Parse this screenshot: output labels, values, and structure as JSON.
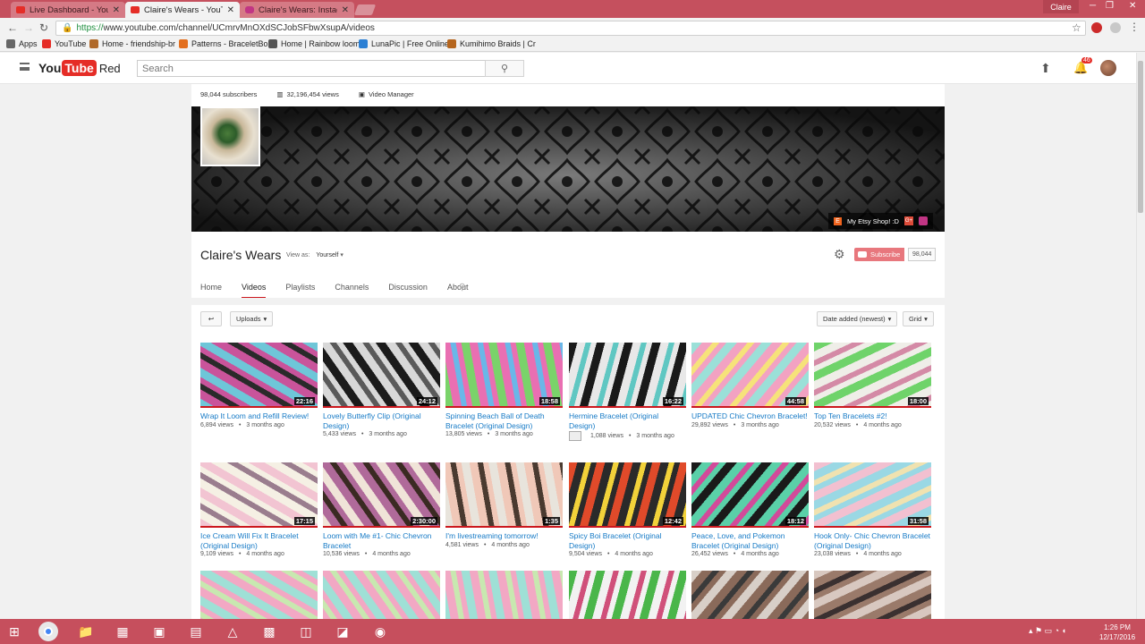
{
  "browser": {
    "tabs": [
      {
        "title": "Live Dashboard - YouTu",
        "icon": "youtube-favicon"
      },
      {
        "title": "Claire's Wears - YouTube",
        "icon": "youtube-favicon"
      },
      {
        "title": "Claire's Wears: Instagram",
        "icon": "instagram-favicon"
      }
    ],
    "profile_name": "Claire",
    "url_scheme": "https://",
    "url_rest": "www.youtube.com/channel/UCmrvMnOXdSCJobSFbwXsupA/videos",
    "bookmarks": [
      {
        "label": "Apps",
        "color": "#666666"
      },
      {
        "label": "YouTube",
        "color": "#e52d27"
      },
      {
        "label": "Home - friendship-br",
        "color": "#b06a2a"
      },
      {
        "label": "Patterns - BraceletBo",
        "color": "#e36f1e"
      },
      {
        "label": "Home | Rainbow loom",
        "color": "#555555"
      },
      {
        "label": "LunaPic | Free Online",
        "color": "#2a7fd4"
      },
      {
        "label": "Kumihimo Braids | Cr",
        "color": "#b5651d"
      }
    ]
  },
  "youtube": {
    "logo_you": "You",
    "logo_tube": "Tube",
    "logo_red": "Red",
    "search_placeholder": "Search",
    "notif_count": "46"
  },
  "channel": {
    "subscribers": "98,044 subscribers",
    "views": "32,196,454 views",
    "video_manager": "Video Manager",
    "name": "Claire's Wears",
    "view_as_label": "View as:",
    "view_as_value": "Yourself",
    "etsy_link": "My Etsy Shop! :D",
    "subscribe_label": "Subscribe",
    "subscribe_count": "98,044",
    "nav_tabs": [
      "Home",
      "Videos",
      "Playlists",
      "Channels",
      "Discussion",
      "About"
    ],
    "uploads_label": "Uploads",
    "sort_label": "Date added (newest)",
    "layout_label": "Grid"
  },
  "videos": [
    {
      "title": "Wrap It Loom and Refill Review!",
      "views": "6,894 views",
      "age": "3 months ago",
      "duration": "22:16",
      "colors": [
        "#6ec6d8",
        "#c9549b",
        "#2a2a2a"
      ]
    },
    {
      "title": "Lovely Butterfly Clip (Original Design)",
      "views": "5,433 views",
      "age": "3 months ago",
      "duration": "24:12",
      "colors": [
        "#1b1b1b",
        "#d8d8d8",
        "#5a5a5a"
      ]
    },
    {
      "title": "Spinning Beach Ball of Death Bracelet (Original Design)",
      "views": "13,805 views",
      "age": "3 months ago",
      "duration": "18:58",
      "colors": [
        "#7ad36a",
        "#e96fb2",
        "#6ab7e8"
      ]
    },
    {
      "title": "Hermine Bracelet (Original Design)",
      "views": "1,088 views",
      "age": "3 months ago",
      "duration": "16:22",
      "colors": [
        "#1a1a1a",
        "#e8e8e8",
        "#5fc7c2"
      ]
    },
    {
      "title": "UPDATED Chic Chevron Bracelet!",
      "views": "29,892 views",
      "age": "3 months ago",
      "duration": "44:58",
      "colors": [
        "#9be0d8",
        "#f2a2c2",
        "#f6e27a"
      ]
    },
    {
      "title": "Top Ten Bracelets #2!",
      "views": "20,532 views",
      "age": "4 months ago",
      "duration": "18:00",
      "colors": [
        "#6fd36a",
        "#efeee8",
        "#d48aa6"
      ]
    },
    {
      "title": "Ice Cream Will Fix It Bracelet (Original Design)",
      "views": "9,109 views",
      "age": "4 months ago",
      "duration": "17:15",
      "colors": [
        "#f2c4d2",
        "#f5f0e4",
        "#9a7d8e"
      ]
    },
    {
      "title": "Loom with Me #1- Chic Chevron Bracelet",
      "views": "10,536 views",
      "age": "4 months ago",
      "duration": "2:30:00",
      "colors": [
        "#f0e4d8",
        "#b06a9a",
        "#3a2a22"
      ]
    },
    {
      "title": "I'm livestreaming tomorrow!",
      "views": "4,581 views",
      "age": "4 months ago",
      "duration": "1:35",
      "colors": [
        "#e8e4dc",
        "#f0c8b8",
        "#4a3a30"
      ]
    },
    {
      "title": "Spicy Boi Bracelet (Original Design)",
      "views": "9,504 views",
      "age": "4 months ago",
      "duration": "12:42",
      "colors": [
        "#e04a2a",
        "#2a2a2a",
        "#f2d23a"
      ]
    },
    {
      "title": "Peace, Love, and Pokemon Bracelet (Original Design)",
      "views": "26,452 views",
      "age": "4 months ago",
      "duration": "18:12",
      "colors": [
        "#1a1a1a",
        "#5ad0a8",
        "#d24a9a"
      ]
    },
    {
      "title": "Hook Only- Chic Chevron Bracelet (Original Design)",
      "views": "23,038 views",
      "age": "4 months ago",
      "duration": "31:58",
      "colors": [
        "#f2c0d0",
        "#9ad8e4",
        "#f0e2b0"
      ]
    },
    {
      "title": "",
      "views": "",
      "age": "",
      "duration": "",
      "colors": [
        "#9fe0d6",
        "#f2a8c4",
        "#c8e8b0"
      ]
    },
    {
      "title": "",
      "views": "",
      "age": "",
      "duration": "",
      "colors": [
        "#9fe0d6",
        "#f2a8c4",
        "#c8e8b0"
      ]
    },
    {
      "title": "",
      "views": "",
      "age": "",
      "duration": "",
      "colors": [
        "#9fe0d6",
        "#f2a8c4",
        "#c8e8b0"
      ]
    },
    {
      "title": "",
      "views": "",
      "age": "",
      "duration": "",
      "colors": [
        "#4ab64a",
        "#f2f2f2",
        "#d0507a"
      ]
    },
    {
      "title": "",
      "views": "",
      "age": "",
      "duration": "",
      "colors": [
        "#d8cfc8",
        "#8a6a5a",
        "#3a3a3a"
      ]
    },
    {
      "title": "",
      "views": "",
      "age": "",
      "duration": "",
      "colors": [
        "#d8c8c0",
        "#9a7a6a",
        "#3a3030"
      ]
    }
  ],
  "taskbar": {
    "time": "1:26 PM",
    "date": "12/17/2016",
    "accent": "#c64f5d"
  }
}
